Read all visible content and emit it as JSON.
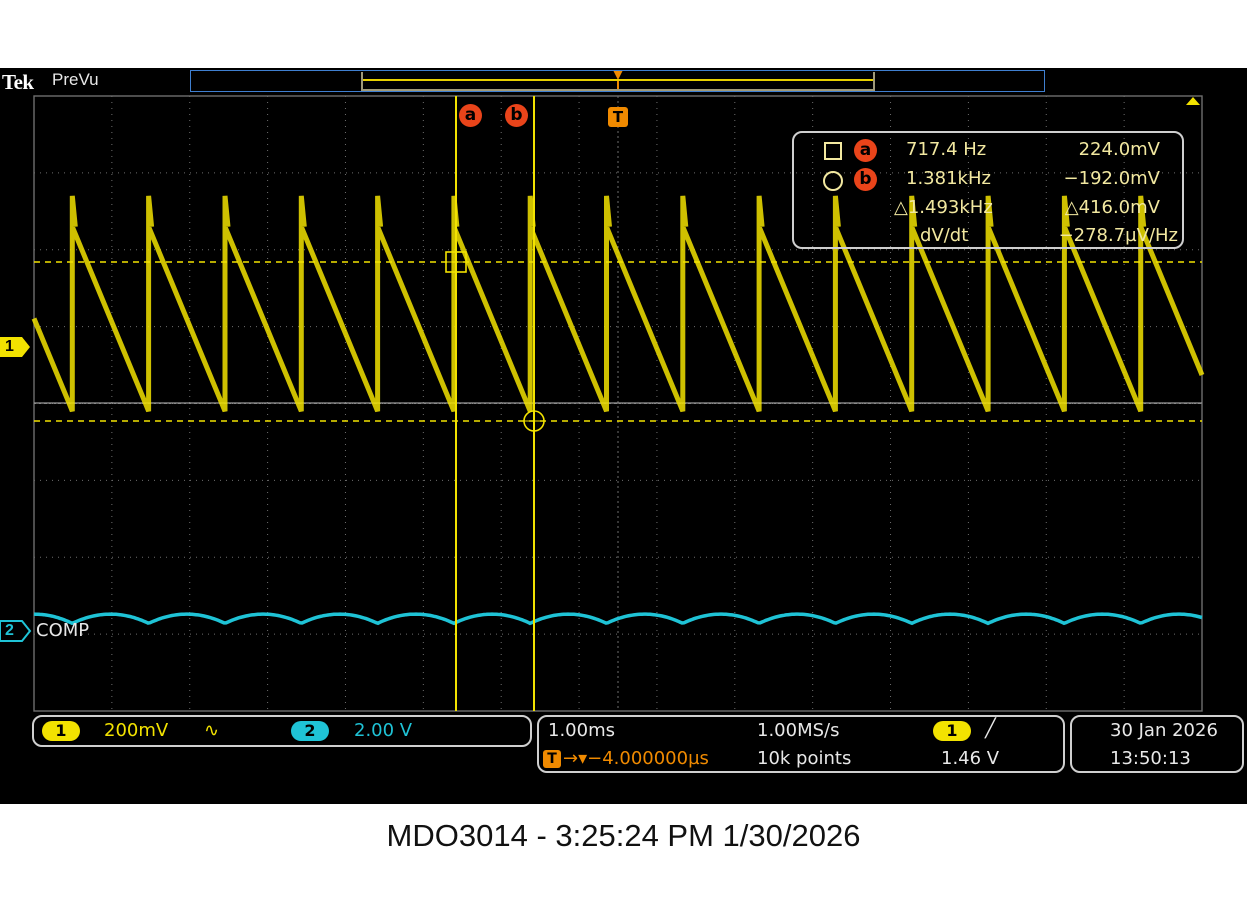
{
  "header": {
    "brand": "Tek",
    "mode": "PreVu",
    "trigger_marker": "T"
  },
  "cursors": {
    "a_label": "a",
    "b_label": "b"
  },
  "readout": {
    "row_a": {
      "symbol": "square",
      "cursor": "a",
      "freq": "717.4 Hz",
      "volt": "224.0mV"
    },
    "row_b": {
      "symbol": "circle",
      "cursor": "b",
      "freq": "1.381kHz",
      "volt": "−192.0mV"
    },
    "delta": {
      "freq": "△1.493kHz",
      "volt": "△416.0mV"
    },
    "slope": {
      "label": "dV/dt",
      "value": "−278.7µV/Hz"
    }
  },
  "channels": [
    {
      "number": "1",
      "color": "#f2e200",
      "label": "",
      "scale": "200mV",
      "coupling": "∿"
    },
    {
      "number": "2",
      "color": "#1fc3d6",
      "label": "COMP",
      "scale": "2.00 V"
    }
  ],
  "timebase": {
    "scale": "1.00ms",
    "sample_rate": "1.00MS/s",
    "position": "→▾−4.000000µs",
    "record_length": "10k points"
  },
  "trigger": {
    "source": "1",
    "slope_icon": "rising-edge-icon",
    "slope_glyph": "╱",
    "level": "1.46 V"
  },
  "datetime": {
    "date": "30 Jan  2026",
    "time": "13:50:13"
  },
  "caption": "MDO3014 - 3:25:24 PM    1/30/2026",
  "colors": {
    "ch1": "#f2e200",
    "ch2": "#1fc3d6",
    "cursor": "#e9441a",
    "trigger": "#f08a00",
    "grid": "#6e6e6e",
    "record_bar": "#3f7fd0"
  },
  "signals": {
    "ch1": {
      "waveform": "sawtooth",
      "period_divisions": 0.98,
      "top_divisions": 2.3,
      "bottom_divisions": -0.1,
      "peak_divisions": 2.7
    },
    "ch2": {
      "waveform": "ripple",
      "offset_divisions": -2.8,
      "ripple_divisions": 0.12
    }
  }
}
